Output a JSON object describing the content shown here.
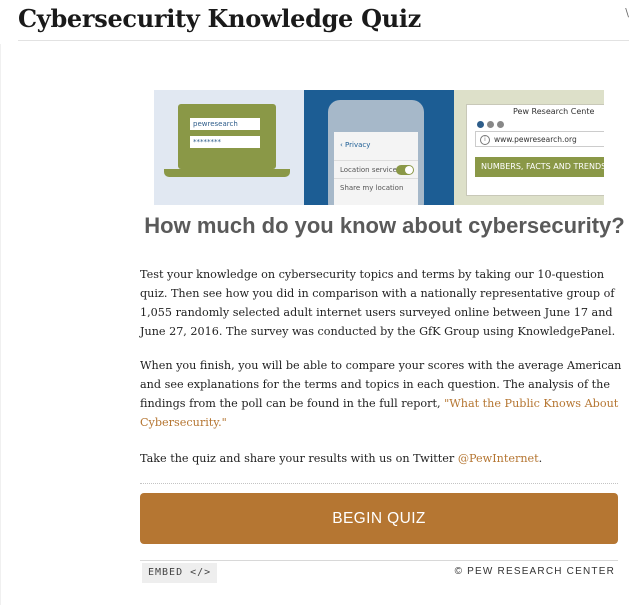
{
  "page": {
    "title": "Cybersecurity Knowledge Quiz",
    "right_mark": "\\"
  },
  "hero": {
    "laptop": {
      "username": "pewresearch",
      "password": "********"
    },
    "phone": {
      "back_label": "Privacy",
      "rows": [
        "Location services",
        "Share my location"
      ]
    },
    "browser": {
      "tab_label": "Pew Research Cente",
      "url": "www.pewresearch.org",
      "banner": "NUMBERS, FACTS AND TRENDS"
    }
  },
  "quiz": {
    "heading": "How much do you know about cybersecurity?",
    "intro": "Test your knowledge on cybersecurity topics and terms by taking our 10-question quiz. Then see how you did in comparison with a nationally representative group of 1,055 randomly selected adult internet users surveyed online between June 17 and June 27, 2016. The survey was conducted by the GfK Group using KnowledgePanel.",
    "finish_text": "When you finish, you will be able to compare your scores with the average American and see explanations for the terms and topics in each question. The analysis of the findings from the poll can be found in the full report, ",
    "report_link": "\"What the Public Knows About Cybersecurity.\"",
    "share_text": "Take the quiz and share your results with us on Twitter ",
    "twitter_link": "@PewInternet",
    "share_end": ".",
    "begin_label": "BEGIN QUIZ"
  },
  "footer": {
    "embed_label": "EMBED </>",
    "copyright": "© PEW RESEARCH CENTER"
  },
  "colors": {
    "accent": "#b57632",
    "olive": "#8a9847",
    "blue": "#1c5d94"
  }
}
